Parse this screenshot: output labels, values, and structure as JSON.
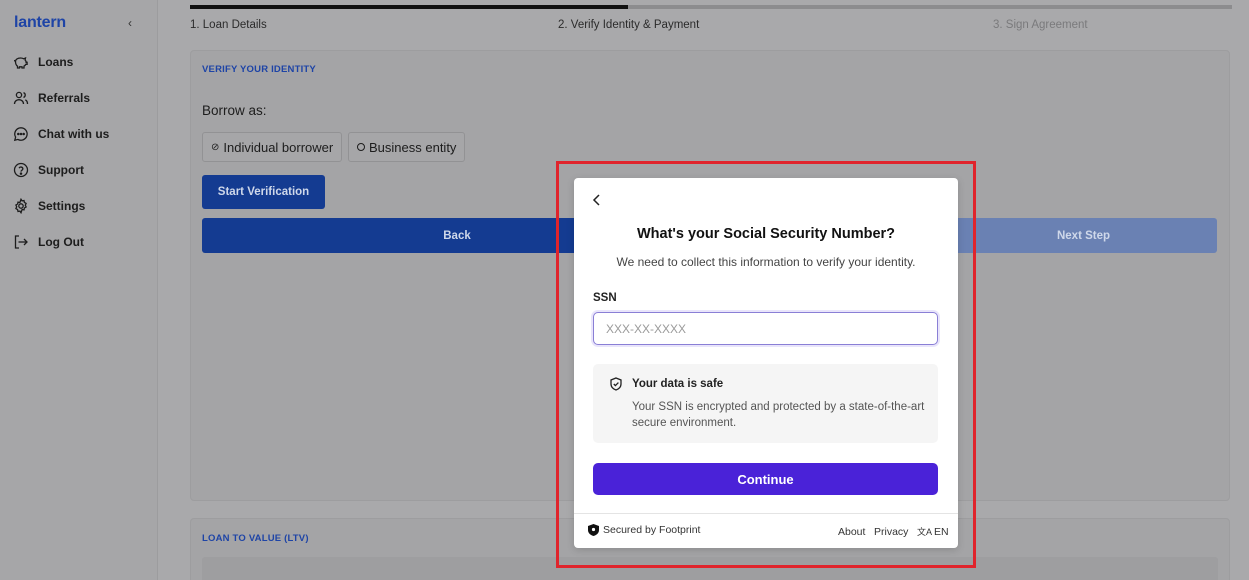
{
  "app": {
    "logo": "lantern",
    "collapse_icon": "‹"
  },
  "sidebar": {
    "items": [
      {
        "label": "Loans",
        "icon": "piggy-bank-icon"
      },
      {
        "label": "Referrals",
        "icon": "users-icon"
      },
      {
        "label": "Chat with us",
        "icon": "chat-icon"
      },
      {
        "label": "Support",
        "icon": "help-circle-icon"
      },
      {
        "label": "Settings",
        "icon": "gear-icon"
      },
      {
        "label": "Log Out",
        "icon": "logout-icon"
      }
    ]
  },
  "stepper": {
    "progress": 0.42,
    "steps": [
      {
        "label": "1. Loan Details",
        "state": "complete"
      },
      {
        "label": "2. Verify Identity & Payment",
        "state": "current"
      },
      {
        "label": "3. Sign Agreement",
        "state": "upcoming"
      }
    ]
  },
  "verify": {
    "title": "VERIFY YOUR IDENTITY",
    "borrow_label": "Borrow as:",
    "options": [
      "Individual borrower",
      "Business entity"
    ],
    "start_button": "Start Verification",
    "back_button": "Back",
    "next_button": "Next Step"
  },
  "ltv": {
    "title": "LOAN TO VALUE (LTV)"
  },
  "modal": {
    "title": "What's your Social Security Number?",
    "subtitle": "We need to collect this information to verify your identity.",
    "ssn_label": "SSN",
    "ssn_placeholder": "XXX-XX-XXXX",
    "ssn_value": "",
    "safe_title": "Your data is safe",
    "safe_text": "Your SSN is encrypted and protected by a state-of-the-art secure environment.",
    "continue_button": "Continue",
    "footer": {
      "secured": "Secured by Footprint",
      "about": "About",
      "privacy": "Privacy",
      "language": "EN"
    },
    "accent_color": "#4a22d8"
  }
}
